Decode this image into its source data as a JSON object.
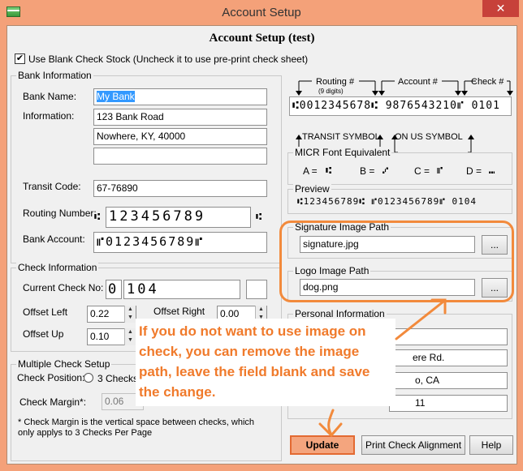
{
  "window": {
    "title": "Account Setup",
    "close_glyph": "✕"
  },
  "form": {
    "title": "Account Setup (test)",
    "blank_check_label": "Use Blank Check Stock (Uncheck it to use pre-print check sheet)",
    "blank_check_checked": true
  },
  "bank": {
    "legend": "Bank Information",
    "bank_name_label": "Bank Name:",
    "bank_name_value": "My Bank",
    "information_label": "Information:",
    "info_line1": "123 Bank Road",
    "info_line2": "Nowhere, KY, 40000",
    "info_line3": "",
    "transit_label": "Transit Code:",
    "transit_value": "67-76890",
    "routing_label": "Routing Number:",
    "routing_value": "123456789",
    "routing_symbol": "⑆",
    "account_label": "Bank Account:",
    "account_value": "⑈0123456789⑈"
  },
  "check_info": {
    "legend": "Check Information",
    "current_label": "Current Check No:",
    "current_prefix": "0",
    "current_value": "104",
    "current_suffix": "",
    "offset_left_label": "Offset Left",
    "offset_left_value": "0.22",
    "offset_right_label": "Offset Right",
    "offset_right_value": "0.00",
    "offset_up_label": "Offset Up",
    "offset_up_value": "0.10",
    "spin_up": "▲",
    "spin_down": "▼"
  },
  "multi": {
    "legend": "Multiple Check Setup",
    "position_label": "Check Position:",
    "radio_label": "3 Checks",
    "margin_label": "Check Margin*:",
    "margin_value": "0.06",
    "note": "* Check Margin is the vertical space between checks, which only applys to 3 Checks Per Page"
  },
  "micr_diagram": {
    "routing_label": "Routing #",
    "routing_sub": "(9 digits)",
    "account_label": "Account #",
    "check_label": "Check #",
    "micr_line": "⑆0012345678⑆  9876543210⑈  0101",
    "transit_symbol_label": "TRANSIT SYMBOL",
    "onus_symbol_label": "ON US SYMBOL",
    "arrow_left": "◄",
    "arrow_right": "►",
    "arrow_down": "▼",
    "arrow_up": "▲"
  },
  "micr_font": {
    "legend": "MICR Font Equivalent",
    "a_label": "A =",
    "a_glyph": "⑆",
    "b_label": "B =",
    "b_glyph": "⑇",
    "c_label": "C =",
    "c_glyph": "⑈",
    "d_label": "D =",
    "d_glyph": "⑉"
  },
  "preview": {
    "legend": "Preview",
    "text": "⑆123456789⑆  ⑈0123456789⑈  0104"
  },
  "signature": {
    "legend": "Signature Image Path",
    "value": "signature.jpg",
    "browse": "..."
  },
  "logo": {
    "legend": "Logo Image Path",
    "value": "dog.png",
    "browse": "..."
  },
  "personal": {
    "legend": "Personal Information",
    "partial_line1": "ere Rd.",
    "partial_line2": "o, CA",
    "partial_line3": "11"
  },
  "callout": {
    "text": "If you do not want to use image on check, you can remove the image path, leave the field blank and save the change."
  },
  "buttons": {
    "update": "Update",
    "print_alignment": "Print Check Alignment",
    "help": "Help"
  },
  "colors": {
    "accent_orange": "#f28a3c",
    "frame": "#f4a179",
    "selection": "#3399ff"
  }
}
